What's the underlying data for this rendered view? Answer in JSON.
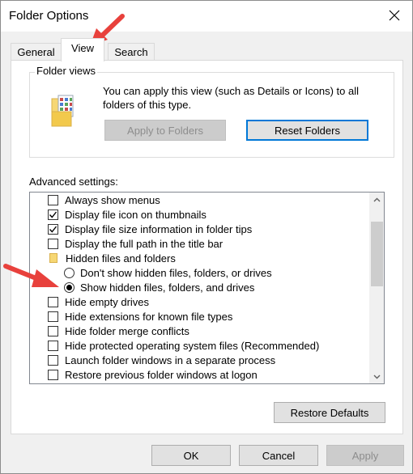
{
  "window": {
    "title": "Folder Options"
  },
  "tabs": [
    {
      "label": "General"
    },
    {
      "label": "View"
    },
    {
      "label": "Search"
    }
  ],
  "folder_views": {
    "heading": "Folder views",
    "description": "You can apply this view (such as Details or Icons) to all folders of this type.",
    "apply_button": "Apply to Folders",
    "reset_button": "Reset Folders"
  },
  "advanced": {
    "label": "Advanced settings:",
    "items": [
      {
        "type": "checkbox",
        "label": "Always show menus",
        "checked": false,
        "indent": 0
      },
      {
        "type": "checkbox",
        "label": "Display file icon on thumbnails",
        "checked": true,
        "indent": 0
      },
      {
        "type": "checkbox",
        "label": "Display file size information in folder tips",
        "checked": true,
        "indent": 0
      },
      {
        "type": "checkbox",
        "label": "Display the full path in the title bar",
        "checked": false,
        "indent": 0
      },
      {
        "type": "folder",
        "label": "Hidden files and folders",
        "indent": 0
      },
      {
        "type": "radio",
        "label": "Don't show hidden files, folders, or drives",
        "checked": false,
        "indent": 1
      },
      {
        "type": "radio",
        "label": "Show hidden files, folders, and drives",
        "checked": true,
        "indent": 1
      },
      {
        "type": "checkbox",
        "label": "Hide empty drives",
        "checked": false,
        "indent": 0
      },
      {
        "type": "checkbox",
        "label": "Hide extensions for known file types",
        "checked": false,
        "indent": 0
      },
      {
        "type": "checkbox",
        "label": "Hide folder merge conflicts",
        "checked": false,
        "indent": 0
      },
      {
        "type": "checkbox",
        "label": "Hide protected operating system files (Recommended)",
        "checked": false,
        "indent": 0
      },
      {
        "type": "checkbox",
        "label": "Launch folder windows in a separate process",
        "checked": false,
        "indent": 0
      },
      {
        "type": "checkbox",
        "label": "Restore previous folder windows at logon",
        "checked": false,
        "indent": 0
      }
    ],
    "restore_button": "Restore Defaults"
  },
  "footer": {
    "ok": "OK",
    "cancel": "Cancel",
    "apply": "Apply"
  },
  "colors": {
    "focus_border": "#0078d7",
    "annotation_arrow": "#e8413c"
  }
}
